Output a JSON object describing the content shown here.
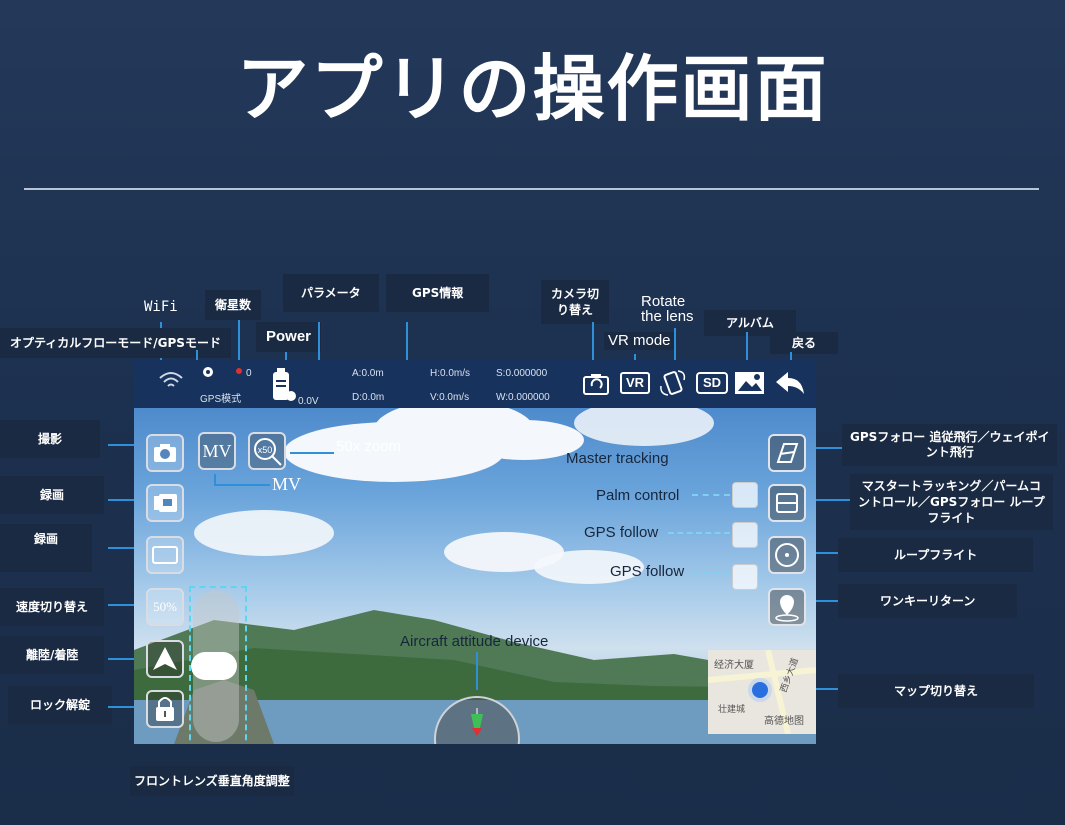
{
  "title": "アプリの操作画面",
  "callouts": {
    "wifi": "WiFi",
    "satellites": "衛星数",
    "parameters": "パラメータ",
    "gps_info": "GPS情報",
    "camera_switch_1": "カメラ切",
    "camera_switch_2": "り替え",
    "rotate_1": "Rotate",
    "rotate_2": "the lens",
    "album": "アルバム",
    "optical_flow": "オプティカルフローモード/GPSモード",
    "power": "Power",
    "vr_mode": "VR mode",
    "back": "戻る",
    "shoot": "撮影",
    "record1": "録画",
    "record2": "録画",
    "speed": "速度切り替え",
    "takeoff": "離陸/着陸",
    "unlock": "ロック解錠",
    "lens_angle": "フロントレンズ垂直角度調整",
    "zoom": "50x zoom",
    "mv": "MV",
    "master_tracking": "Master tracking",
    "palm_control": "Palm control",
    "gps_follow_1": "GPS follow",
    "gps_follow_2": "GPS follow",
    "attitude": "Aircraft attitude device",
    "gps_follow_right_1": "GPSフォロー 追従飛行／ウェイポイ",
    "gps_follow_right_2": "ント飛行",
    "master_right_1": "マスタートラッキング／パームコ",
    "master_right_2": "ントロール／GPSフォロー ループ",
    "master_right_3": "フライト",
    "loop_flight": "ループフライト",
    "one_key_return": "ワンキーリターン",
    "map_switch": "マップ切り替え"
  },
  "screen": {
    "gps_mode": "GPS模式",
    "satellite_count": "0",
    "voltage": "0.0V",
    "altitude": "A:0.0m",
    "distance": "D:0.0m",
    "h_speed": "H:0.0m/s",
    "v_speed": "V:0.0m/s",
    "s_coord": "S:0.000000",
    "w_coord": "W:0.000000",
    "sd_label": "SD",
    "vr_label": "VR",
    "mv_button": "MV",
    "zoom_button": "x50",
    "speed_button": "50%",
    "map_text_1": "经济大厦",
    "map_text_2": "西乡大道",
    "map_text_3": "壮建城",
    "map_text_4": "高德地图"
  },
  "colors": {
    "callout_bg": "#1a2a42",
    "connector": "#2f8fd8",
    "dash": "#7fd0f2",
    "topbar": "#17325c"
  }
}
